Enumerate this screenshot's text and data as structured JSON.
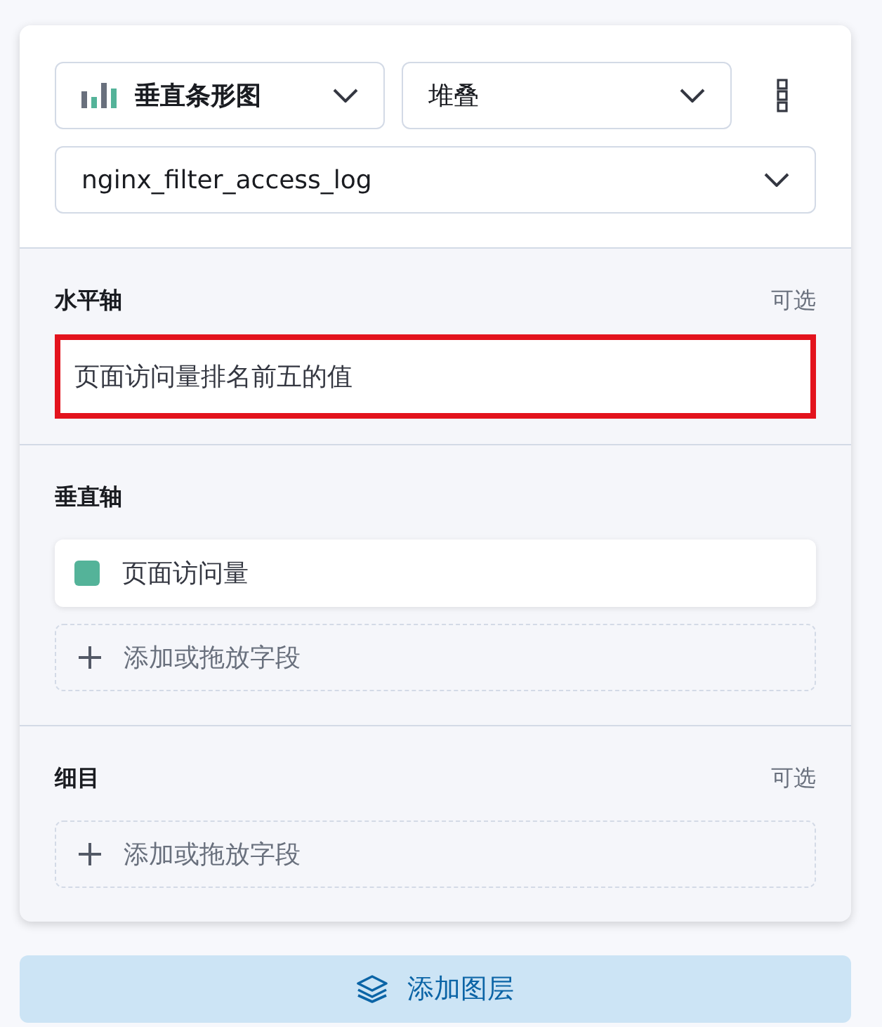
{
  "layer": {
    "chart_type": {
      "label": "垂直条形图"
    },
    "mode": {
      "value": "堆叠"
    },
    "data_view": {
      "value": "nginx_filter_access_log"
    }
  },
  "sections": [
    {
      "title": "水平轴",
      "optional_label": "可选",
      "fields": [
        {
          "kind": "value",
          "label": "页面访问量排名前五的值",
          "highlighted": true
        }
      ]
    },
    {
      "title": "垂直轴",
      "fields": [
        {
          "kind": "metric",
          "label": "页面访问量",
          "color": "#54b399",
          "highlighted": false
        },
        {
          "kind": "add",
          "label": "添加或拖放字段",
          "highlighted": false
        }
      ]
    },
    {
      "title": "细目",
      "optional_label": "可选",
      "fields": [
        {
          "kind": "add",
          "label": "添加或拖放字段",
          "highlighted": false
        }
      ]
    }
  ],
  "add_layer_button": {
    "label": "添加图层"
  }
}
